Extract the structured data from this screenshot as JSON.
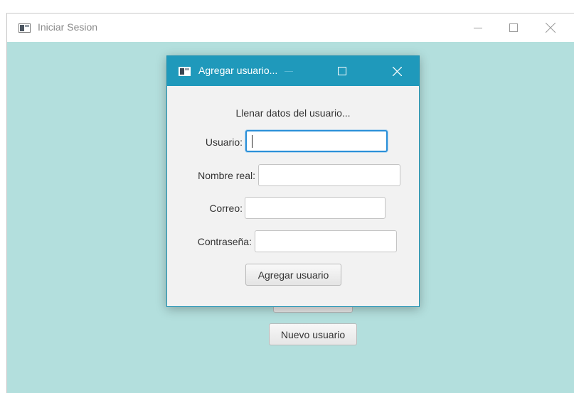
{
  "main_window": {
    "title": "Iniciar Sesion",
    "new_user_button": "Nuevo usuario"
  },
  "dialog": {
    "title": "Agregar usuario...",
    "heading": "Llenar datos del usuario...",
    "fields": [
      {
        "label": "Usuario:",
        "value": "",
        "focused": true
      },
      {
        "label": "Nombre real:",
        "value": ""
      },
      {
        "label": "Correo:",
        "value": ""
      },
      {
        "label": "Contraseña:",
        "value": ""
      }
    ],
    "submit_button": "Agregar usuario"
  },
  "colors": {
    "main_background": "#b3dfdd",
    "dialog_titlebar": "#1f99bb",
    "focus_border": "#2a8fd8"
  },
  "icons": [
    "app-icon",
    "minimize-icon",
    "maximize-icon",
    "close-icon"
  ]
}
